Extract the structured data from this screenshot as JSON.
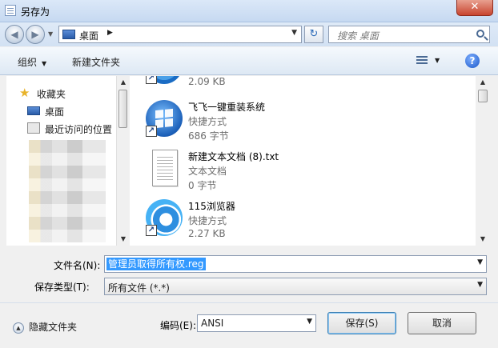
{
  "window": {
    "title": "另存为",
    "close": "✕"
  },
  "nav": {
    "back": "◀",
    "forward": "▶"
  },
  "address": {
    "location": "桌面",
    "arrow": "▶",
    "dropdown": "▼"
  },
  "search": {
    "placeholder": "搜索 桌面"
  },
  "toolbar": {
    "organize": "组织",
    "new_folder": "新建文件夹",
    "help": "?"
  },
  "sidebar": {
    "items": [
      {
        "label": "收藏夹",
        "icon": "star-icon"
      },
      {
        "label": "桌面",
        "icon": "desktop-icon"
      },
      {
        "label": "最近访问的位置",
        "icon": "recent-places-icon"
      }
    ]
  },
  "files": [
    {
      "name": "",
      "type": "",
      "size": "2.09 KB",
      "icon": "ie-shortcut-icon"
    },
    {
      "name": "飞飞一键重装系统",
      "type": "快捷方式",
      "size": "686 字节",
      "icon": "windows-shortcut-icon"
    },
    {
      "name": "新建文本文档 (8).txt",
      "type": "文本文档",
      "size": "0 字节",
      "icon": "text-file-icon"
    },
    {
      "name": "115浏览器",
      "type": "快捷方式",
      "size": "2.27 KB",
      "icon": "115-browser-shortcut-icon"
    }
  ],
  "form": {
    "filename_label": "文件名(N):",
    "filename_value": "管理员取得所有权.reg",
    "filetype_label": "保存类型(T):",
    "filetype_value": "所有文件  (*.*)",
    "encoding_label": "编码(E):",
    "encoding_value": "ANSI"
  },
  "footer": {
    "hide_folders": "隐藏文件夹"
  },
  "buttons": {
    "save": "保存(S)",
    "cancel": "取消"
  }
}
